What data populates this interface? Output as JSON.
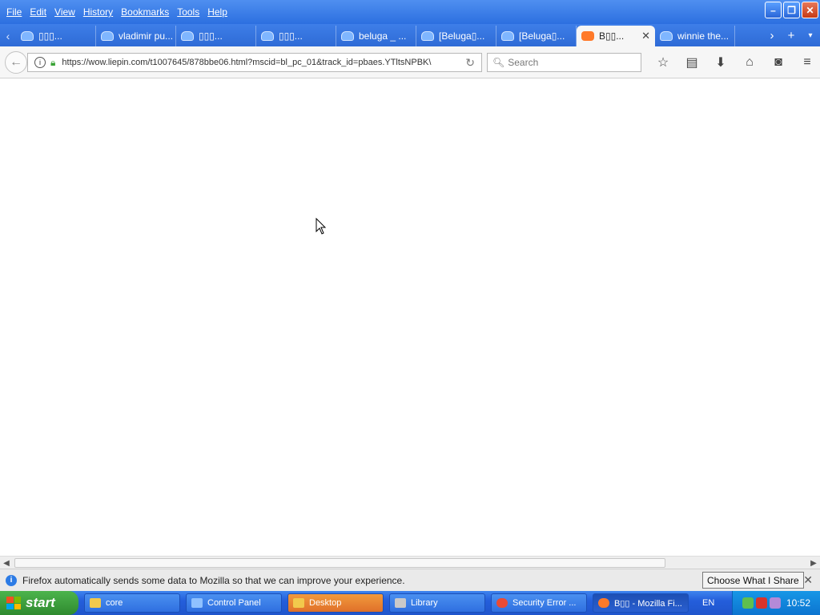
{
  "menu": [
    "File",
    "Edit",
    "View",
    "History",
    "Bookmarks",
    "Tools",
    "Help"
  ],
  "window_controls": {
    "minimize": "–",
    "restore": "❐",
    "close": "✕"
  },
  "tabs": [
    {
      "title": "▯▯▯...",
      "active": false
    },
    {
      "title": "vladimir pu...",
      "active": false
    },
    {
      "title": "▯▯▯...",
      "active": false
    },
    {
      "title": "▯▯▯...",
      "active": false
    },
    {
      "title": "beluga _ ...",
      "active": false
    },
    {
      "title": "[Beluga▯...",
      "active": false
    },
    {
      "title": "[Beluga▯...",
      "active": false
    },
    {
      "title": "B▯▯...",
      "active": true
    },
    {
      "title": "winnie the...",
      "active": false
    }
  ],
  "navbar": {
    "url": "https://wow.liepin.com/t1007645/878bbe06.html?mscid=bl_pc_01&track_id=pbaes.YTltsNPBK\\",
    "search_placeholder": "Search"
  },
  "notification": {
    "text": "Firefox automatically sends some data to Mozilla so that we can improve your experience.",
    "button": "Choose What I Share"
  },
  "taskbar": {
    "start_label": "start",
    "tasks": [
      {
        "label": "core",
        "icon": "folder-icon",
        "color": "#f2c94c"
      },
      {
        "label": "Control Panel",
        "icon": "control-panel-icon",
        "color": "#8fc1ff"
      },
      {
        "label": "Desktop",
        "icon": "folder-icon",
        "color": "#f2c94c"
      },
      {
        "label": "Library",
        "icon": "library-icon",
        "color": "#c9c9c9"
      },
      {
        "label": "Security Error ...",
        "icon": "chrome-icon",
        "color": "#e94b35"
      },
      {
        "label": "B▯▯ - Mozilla Fi...",
        "icon": "firefox-icon",
        "color": "#ff7a2a"
      }
    ],
    "language": "EN",
    "clock": "10:52"
  }
}
